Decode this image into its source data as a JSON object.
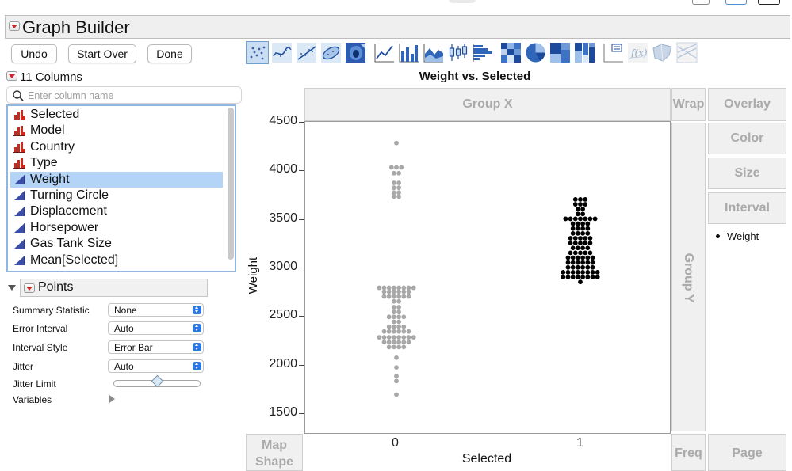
{
  "window": {
    "title": "Graph Builder"
  },
  "actions": {
    "undo": "Undo",
    "start_over": "Start Over",
    "done": "Done"
  },
  "columns": {
    "header": "11 Columns",
    "search_placeholder": "Enter column name",
    "items": [
      {
        "label": "Selected",
        "type": "nominal"
      },
      {
        "label": "Model",
        "type": "nominal"
      },
      {
        "label": "Country",
        "type": "nominal"
      },
      {
        "label": "Type",
        "type": "nominal"
      },
      {
        "label": "Weight",
        "type": "continuous",
        "selected": true
      },
      {
        "label": "Turning Circle",
        "type": "continuous"
      },
      {
        "label": "Displacement",
        "type": "continuous"
      },
      {
        "label": "Horsepower",
        "type": "continuous"
      },
      {
        "label": "Gas Tank Size",
        "type": "continuous"
      },
      {
        "label": "Mean[Selected]",
        "type": "continuous"
      }
    ]
  },
  "points_panel": {
    "title": "Points",
    "props": {
      "summary_statistic": {
        "label": "Summary Statistic",
        "value": "None"
      },
      "error_interval": {
        "label": "Error Interval",
        "value": "Auto"
      },
      "interval_style": {
        "label": "Interval Style",
        "value": "Error Bar"
      },
      "jitter": {
        "label": "Jitter",
        "value": "Auto"
      },
      "jitter_limit": {
        "label": "Jitter Limit",
        "value": 0.5
      },
      "variables": {
        "label": "Variables"
      }
    }
  },
  "toolbar": {
    "icons": [
      "points-icon",
      "smoother-icon",
      "line-of-fit-icon",
      "ellipse-icon",
      "contour-icon",
      "line-icon",
      "bar-icon",
      "area-icon",
      "box-plot-icon",
      "histogram-icon",
      "heatmap-icon",
      "pie-icon",
      "treemap-icon",
      "mosaic-icon",
      "caption-box-icon",
      "formula-icon",
      "map-shapes-icon",
      "parallel-icon"
    ],
    "active": "points-icon"
  },
  "zones": {
    "group_x": "Group X",
    "group_y": "Group Y",
    "wrap": "Wrap",
    "overlay": "Overlay",
    "color": "Color",
    "size": "Size",
    "interval": "Interval",
    "map_shape": "Map Shape",
    "freq": "Freq",
    "page": "Page"
  },
  "legend": {
    "items": [
      "Weight"
    ]
  },
  "chart_data": {
    "type": "scatter",
    "title": "Weight vs. Selected",
    "xlabel": "Selected",
    "ylabel": "Weight",
    "categories": [
      "0",
      "1"
    ],
    "ylim": [
      1400,
      4550
    ],
    "yticks": [
      1500,
      2000,
      2500,
      3000,
      3500,
      4000,
      4500
    ],
    "grid": false,
    "series": [
      {
        "name": "0",
        "color": "#a8a8a8",
        "points": [
          {
            "y": 4290,
            "n": 1
          },
          {
            "y": 4040,
            "n": 3
          },
          {
            "y": 3980,
            "n": 2
          },
          {
            "y": 3880,
            "n": 2
          },
          {
            "y": 3830,
            "n": 2
          },
          {
            "y": 3780,
            "n": 2
          },
          {
            "y": 3740,
            "n": 2
          },
          {
            "y": 2800,
            "n": 8
          },
          {
            "y": 2760,
            "n": 6
          },
          {
            "y": 2710,
            "n": 6
          },
          {
            "y": 2660,
            "n": 2
          },
          {
            "y": 2600,
            "n": 2
          },
          {
            "y": 2550,
            "n": 2
          },
          {
            "y": 2500,
            "n": 4
          },
          {
            "y": 2450,
            "n": 2
          },
          {
            "y": 2400,
            "n": 4
          },
          {
            "y": 2350,
            "n": 6
          },
          {
            "y": 2290,
            "n": 8
          },
          {
            "y": 2240,
            "n": 6
          },
          {
            "y": 2190,
            "n": 4
          },
          {
            "y": 2080,
            "n": 1
          },
          {
            "y": 1980,
            "n": 1
          },
          {
            "y": 1890,
            "n": 1
          },
          {
            "y": 1840,
            "n": 1
          },
          {
            "y": 1700,
            "n": 1
          }
        ]
      },
      {
        "name": "1",
        "color": "#000000",
        "points": [
          {
            "y": 3710,
            "n": 3
          },
          {
            "y": 3660,
            "n": 3
          },
          {
            "y": 3610,
            "n": 2
          },
          {
            "y": 3560,
            "n": 2
          },
          {
            "y": 3510,
            "n": 7
          },
          {
            "y": 3460,
            "n": 4
          },
          {
            "y": 3410,
            "n": 4
          },
          {
            "y": 3360,
            "n": 4
          },
          {
            "y": 3310,
            "n": 5
          },
          {
            "y": 3260,
            "n": 5
          },
          {
            "y": 3210,
            "n": 4
          },
          {
            "y": 3160,
            "n": 5
          },
          {
            "y": 3110,
            "n": 6
          },
          {
            "y": 3060,
            "n": 6
          },
          {
            "y": 3010,
            "n": 6
          },
          {
            "y": 2960,
            "n": 8
          },
          {
            "y": 2910,
            "n": 8
          },
          {
            "y": 2860,
            "n": 1
          }
        ]
      }
    ]
  }
}
